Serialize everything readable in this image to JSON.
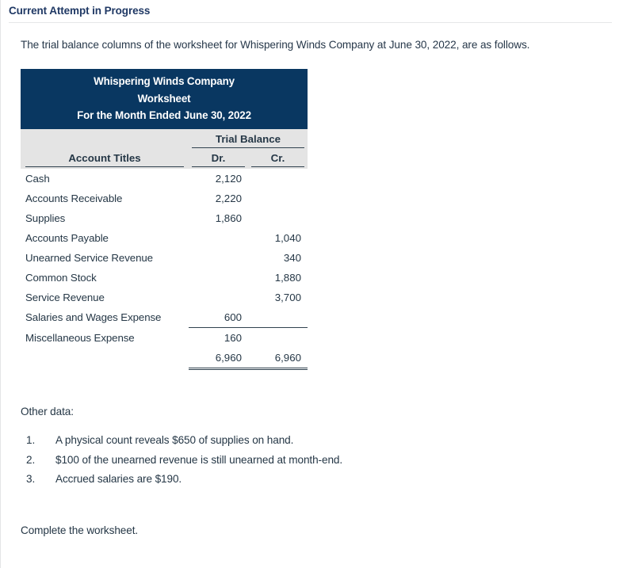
{
  "header": {
    "title": "Current Attempt in Progress"
  },
  "intro": "The trial balance columns of the worksheet for Whispering Winds Company at June 30, 2022, are as follows.",
  "worksheet": {
    "company": "Whispering Winds Company",
    "doc_type": "Worksheet",
    "period": "For the Month Ended June 30, 2022",
    "group_header": "Trial Balance",
    "columns": {
      "accounts": "Account Titles",
      "debit": "Dr.",
      "credit": "Cr."
    },
    "rows": [
      {
        "account": "Cash",
        "dr": "2,120",
        "cr": ""
      },
      {
        "account": "Accounts Receivable",
        "dr": "2,220",
        "cr": ""
      },
      {
        "account": "Supplies",
        "dr": "1,860",
        "cr": ""
      },
      {
        "account": "Accounts Payable",
        "dr": "",
        "cr": "1,040"
      },
      {
        "account": "Unearned Service Revenue",
        "dr": "",
        "cr": "340"
      },
      {
        "account": "Common Stock",
        "dr": "",
        "cr": "1,880"
      },
      {
        "account": "Service Revenue",
        "dr": "",
        "cr": "3,700"
      },
      {
        "account": "Salaries and Wages Expense",
        "dr": "600",
        "cr": ""
      },
      {
        "account": "Miscellaneous Expense",
        "dr": "160",
        "cr": ""
      }
    ],
    "totals": {
      "account": "",
      "dr": "6,960",
      "cr": "6,960"
    }
  },
  "other_data": {
    "label": "Other data:",
    "items": [
      {
        "num": "1.",
        "text": "A physical count reveals $650 of supplies on hand."
      },
      {
        "num": "2.",
        "text": "$100 of the unearned revenue is still unearned at month-end."
      },
      {
        "num": "3.",
        "text": "Accrued salaries are $190."
      }
    ]
  },
  "closing_instruction": "Complete the worksheet.",
  "colors": {
    "header_blue": "#093761",
    "band_gray": "#e4e4e4",
    "text": "#253746",
    "title_navy": "#1f3864"
  }
}
